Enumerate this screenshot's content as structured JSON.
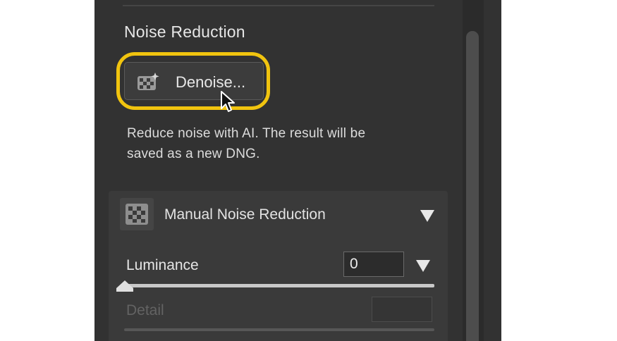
{
  "section": {
    "title": "Noise Reduction",
    "denoise_button": {
      "label": "Denoise...",
      "icon": "denoise-ai-icon"
    },
    "description_line1": "Reduce noise with AI. The result will be",
    "description_line2": "saved as a new DNG."
  },
  "manual": {
    "title": "Manual Noise Reduction",
    "icon": "noise-grid-icon",
    "toggle_icon": "triangle-down-icon",
    "luminance": {
      "label": "Luminance",
      "value": "0",
      "slider_fraction": 0
    },
    "detail": {
      "label": "Detail",
      "value": ""
    }
  },
  "colors": {
    "highlight": "#f1c40f",
    "panel_bg": "#323232",
    "subpanel_bg": "#3a3a3a"
  }
}
